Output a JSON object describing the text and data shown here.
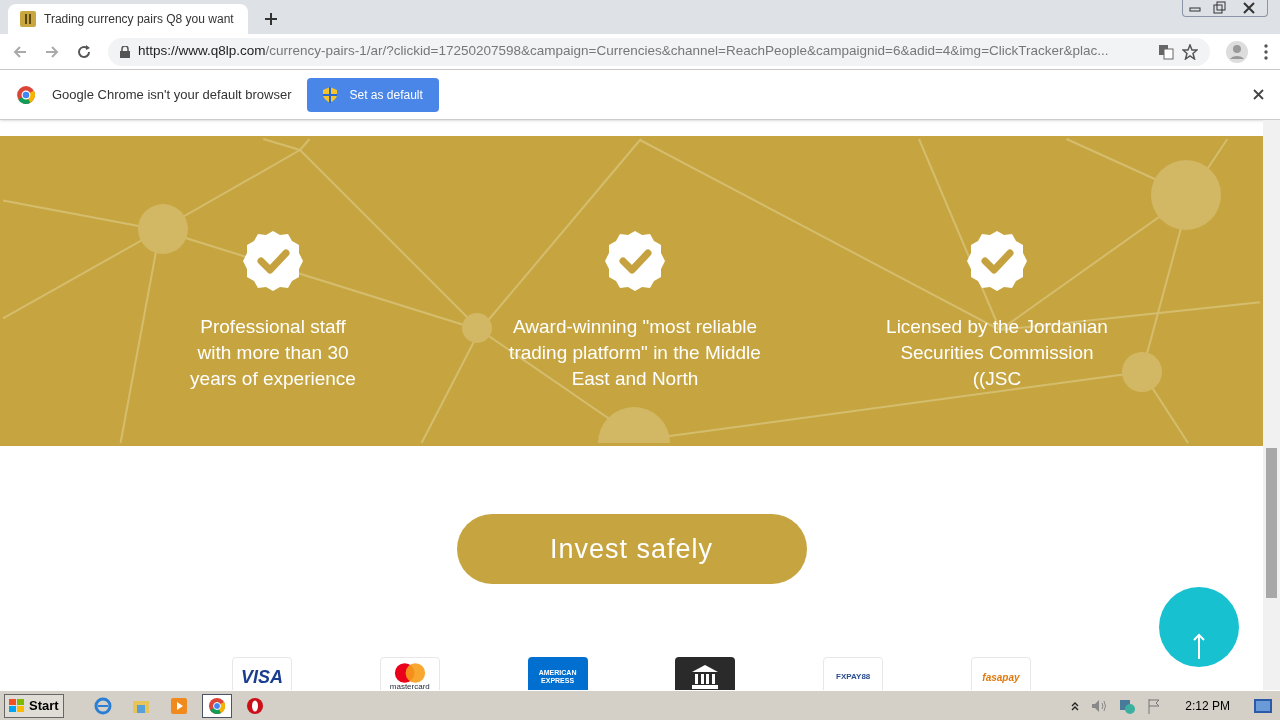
{
  "browser": {
    "tab": {
      "title": "Trading currency pairs Q8 you want",
      "selected": true
    },
    "url": {
      "host": "https://www.q8lp.com",
      "path": "/currency-pairs-1/ar/?clickid=17250207598&campaign=Currencies&channel=ReachPeople&campaignid=6&adid=4&img=ClickTracker&plac..."
    },
    "infobar": {
      "message": "Google Chrome isn't your default browser",
      "button": "Set as default"
    }
  },
  "features": [
    {
      "text": "Professional staff with more than 30 years of experience"
    },
    {
      "text": "Award-winning \"most reliable trading platform\" in the Middle East and North"
    },
    {
      "text": "Licensed by the Jordanian Securities Commission ((JSC"
    }
  ],
  "cta": {
    "label": "Invest safely"
  },
  "payments": [
    {
      "kind": "visa",
      "label": "VISA"
    },
    {
      "kind": "mastercard",
      "label": "mastercard"
    },
    {
      "kind": "amex",
      "label": "AMERICAN EXPRESS"
    },
    {
      "kind": "bank"
    },
    {
      "kind": "fxpay",
      "label": "FXPAY88"
    },
    {
      "kind": "fasapay",
      "label": "fasapay"
    }
  ],
  "taskbar": {
    "start": "Start",
    "apps": [
      {
        "kind": "ie",
        "selected": false
      },
      {
        "kind": "explorer",
        "selected": false
      },
      {
        "kind": "media",
        "selected": false
      },
      {
        "kind": "chrome",
        "selected": true
      },
      {
        "kind": "opera",
        "selected": false
      }
    ],
    "clock": "2:12 PM"
  }
}
